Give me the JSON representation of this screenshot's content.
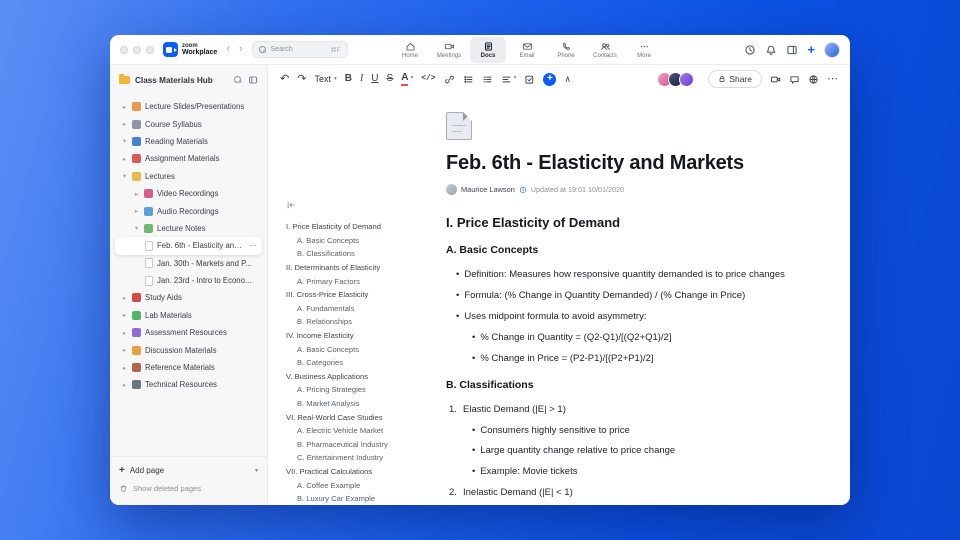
{
  "topbar": {
    "logo_line1": "zoom",
    "logo_line2": "Workplace",
    "search": {
      "placeholder": "Search",
      "shortcut": "⌘F"
    },
    "tabs": [
      {
        "label": "Home"
      },
      {
        "label": "Meetings"
      },
      {
        "label": "Docs",
        "active": true
      },
      {
        "label": "Email"
      },
      {
        "label": "Phone"
      },
      {
        "label": "Contacts"
      },
      {
        "label": "More"
      }
    ]
  },
  "toolbar": {
    "undo_icon": "↶",
    "redo_icon": "↷",
    "style": "Text",
    "bold": "B",
    "italic": "I",
    "underline": "U",
    "strike": "S",
    "color": "A",
    "code": "</>",
    "share": "Share"
  },
  "sidebar": {
    "title": "Class Materials Hub",
    "add_page": "Add page",
    "show_deleted": "Show deleted pages",
    "items": [
      {
        "label": "Lecture Slides/Presentations",
        "level": 0,
        "chevron": "closed",
        "icon": "presentation-icon",
        "color": "#e8984a"
      },
      {
        "label": "Course Syllabus",
        "level": 0,
        "chevron": "closed",
        "icon": "syllabus-icon",
        "color": "#8f98a6"
      },
      {
        "label": "Reading Materials",
        "level": 0,
        "chevron": "open",
        "icon": "book-icon",
        "color": "#4a7fd6"
      },
      {
        "label": "Assignment Materials",
        "level": 0,
        "chevron": "closed",
        "icon": "assignment-icon",
        "color": "#d65b5b"
      },
      {
        "label": "Lectures",
        "level": 0,
        "chevron": "open",
        "icon": "lectures-icon",
        "color": "#e8b84a"
      },
      {
        "label": "Video Recordings",
        "level": 1,
        "chevron": "closed",
        "icon": "video-icon",
        "color": "#d65b8f"
      },
      {
        "label": "Audio Recordings",
        "level": 1,
        "chevron": "closed",
        "icon": "audio-icon",
        "color": "#5b9fd6"
      },
      {
        "label": "Lecture Notes",
        "level": 1,
        "chevron": "open",
        "icon": "notes-icon",
        "color": "#6fb86f"
      },
      {
        "label": "Feb. 6th - Elasticity and M...",
        "level": 2,
        "doc": true,
        "selected": true
      },
      {
        "label": "Jan. 30th - Markets and P...",
        "level": 2,
        "doc": true
      },
      {
        "label": "Jan. 23rd - Intro to Econo...",
        "level": 2,
        "doc": true
      },
      {
        "label": "Study Aids",
        "level": 0,
        "chevron": "closed",
        "icon": "study-icon",
        "color": "#d64a4a"
      },
      {
        "label": "Lab Materials",
        "level": 0,
        "chevron": "closed",
        "icon": "lab-icon",
        "color": "#57b36b"
      },
      {
        "label": "Assessment Resources",
        "level": 0,
        "chevron": "closed",
        "icon": "assessment-icon",
        "color": "#8f6bd6"
      },
      {
        "label": "Discussion Materials",
        "level": 0,
        "chevron": "closed",
        "icon": "discussion-icon",
        "color": "#e8a23d"
      },
      {
        "label": "Reference Materials",
        "level": 0,
        "chevron": "closed",
        "icon": "reference-icon",
        "color": "#b3654a"
      },
      {
        "label": "Technical Resources",
        "level": 0,
        "chevron": "closed",
        "icon": "tools-icon",
        "color": "#6b7684"
      }
    ]
  },
  "outline": {
    "items": [
      {
        "label": "I. Price Elasticity of Demand",
        "level": 0
      },
      {
        "label": "A. Basic Concepts",
        "level": 1
      },
      {
        "label": "B. Classifications",
        "level": 1
      },
      {
        "label": "II. Determinants of Elasticity",
        "level": 0
      },
      {
        "label": "A. Primary Factors",
        "level": 1
      },
      {
        "label": "III. Cross-Price Elasticity",
        "level": 0
      },
      {
        "label": "A. Fundamentals",
        "level": 1
      },
      {
        "label": "B. Relationships",
        "level": 1
      },
      {
        "label": "IV. Income Elasticity",
        "level": 0
      },
      {
        "label": "A. Basic Concepts",
        "level": 1
      },
      {
        "label": "B. Categories",
        "level": 1
      },
      {
        "label": "V. Business Applications",
        "level": 0
      },
      {
        "label": "A. Pricing Strategies",
        "level": 1
      },
      {
        "label": "B. Market Analysis",
        "level": 1
      },
      {
        "label": "VI. Real-World Case Studies",
        "level": 0
      },
      {
        "label": "A. Electric Vehicle Market",
        "level": 1
      },
      {
        "label": "B. Pharmaceutical Industry",
        "level": 1
      },
      {
        "label": "C. Entertainment Industry",
        "level": 1
      },
      {
        "label": "VII. Practical Calculations",
        "level": 0
      },
      {
        "label": "A. Coffee Example",
        "level": 1
      },
      {
        "label": "B. Luxury Car Example",
        "level": 1
      }
    ]
  },
  "document": {
    "title": "Feb. 6th - Elasticity and Markets",
    "author": "Maurice Lawson",
    "updated": "Updated at 19:01 10/01/2020",
    "blocks": [
      {
        "type": "h2",
        "text": "I. Price Elasticity of Demand"
      },
      {
        "type": "h3",
        "text": "A. Basic Concepts"
      },
      {
        "type": "bullet",
        "level": 0,
        "text": "Definition: Measures how responsive quantity demanded is to price changes"
      },
      {
        "type": "bullet",
        "level": 0,
        "text": "Formula: (% Change in Quantity Demanded) / (% Change in Price)"
      },
      {
        "type": "bullet",
        "level": 0,
        "text": "Uses midpoint formula to avoid asymmetry:"
      },
      {
        "type": "bullet",
        "level": 1,
        "text": "% Change in Quantity = (Q2-Q1)/[(Q2+Q1)/2]"
      },
      {
        "type": "bullet",
        "level": 1,
        "text": "% Change in Price = (P2-P1)/[(P2+P1)/2]"
      },
      {
        "type": "h3",
        "text": "B. Classifications"
      },
      {
        "type": "number",
        "num": "1.",
        "text": "Elastic Demand (|E| > 1)"
      },
      {
        "type": "bullet",
        "level": 1,
        "text": "Consumers highly sensitive to price"
      },
      {
        "type": "bullet",
        "level": 1,
        "text": "Large quantity change relative to price change"
      },
      {
        "type": "bullet",
        "level": 1,
        "text": "Example: Movie tickets"
      },
      {
        "type": "number",
        "num": "2.",
        "text": "Inelastic Demand (|E| < 1)"
      }
    ]
  },
  "colors": {
    "accent": "#0b5cff"
  }
}
